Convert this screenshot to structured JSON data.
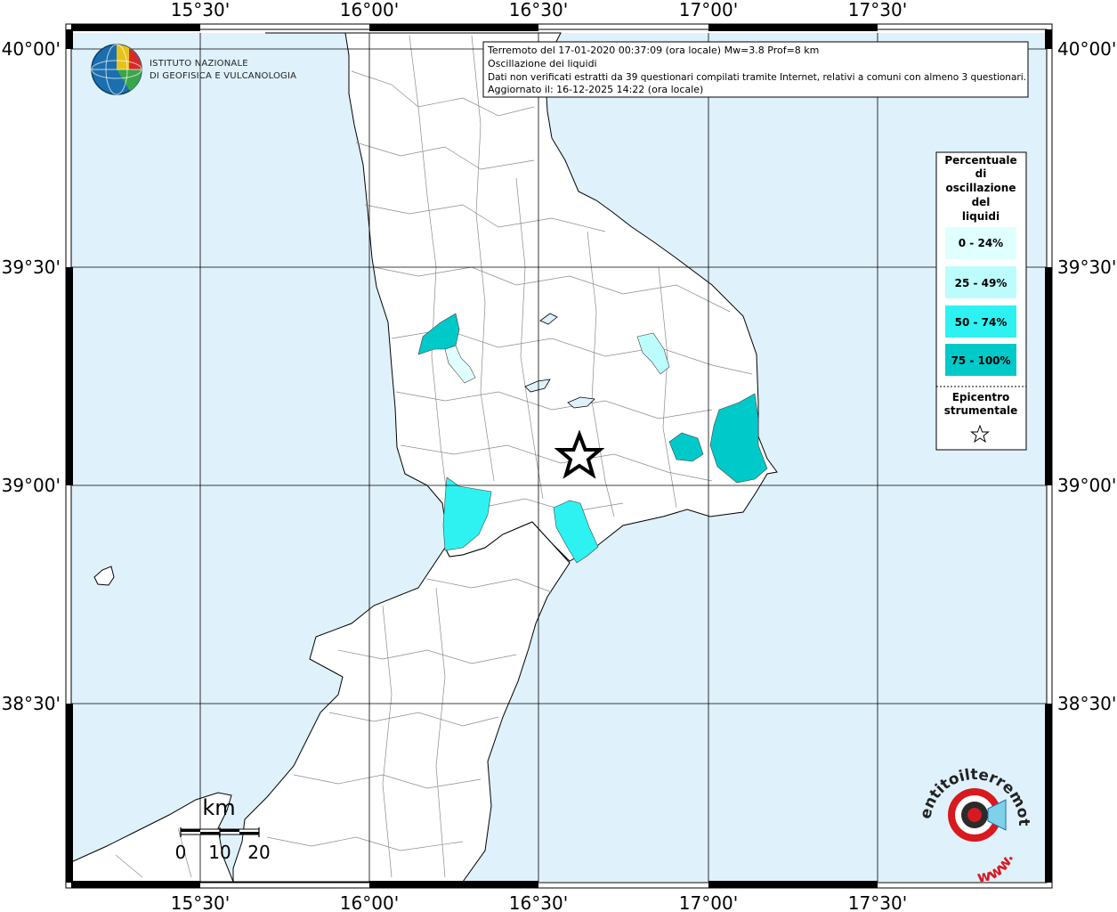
{
  "map": {
    "colors": {
      "sea": "#dff1fb",
      "land": "#ffffff",
      "coast": "#000000",
      "borders": "#8a8a8a",
      "grid": "#000000"
    },
    "longitude_labels": [
      "15°30'",
      "16°00'",
      "16°30'",
      "17°00'",
      "17°30'"
    ],
    "latitude_labels": [
      "40°00'",
      "39°30'",
      "39°00'",
      "38°30'"
    ]
  },
  "logo": {
    "line1": "ISTITUTO NAZIONALE",
    "line2": "DI GEOFISICA E VULCANOLOGIA"
  },
  "info": {
    "line1": "Terremoto del 17-01-2020 00:37:09 (ora locale) Mw=3.8 Prof=8 km",
    "line2": "Oscillazione dei liquidi",
    "line3": "Dati non verificati estratti da 39 questionari compilati tramite Internet, relativi a comuni con almeno 3 questionari.",
    "line4": "Aggiornato il: 16-12-2025 14:22 (ora locale)"
  },
  "legend": {
    "title_lines": [
      "Percentuale",
      "di",
      "oscillazione",
      "del",
      "liquidi"
    ],
    "classes": [
      {
        "label": "0 - 24%",
        "color": "#e0ffff"
      },
      {
        "label": "25 - 49%",
        "color": "#bdfcfc"
      },
      {
        "label": "50 - 74%",
        "color": "#2ef2f2"
      },
      {
        "label": "75 - 100%",
        "color": "#00c9c9"
      }
    ],
    "epicenter_lines": [
      "Epicentro",
      "strumentale"
    ],
    "star_icon": "star-outline-icon"
  },
  "scale_bar": {
    "unit": "km",
    "labels": [
      "0",
      "10",
      "20"
    ]
  },
  "watermark": {
    "text": "haisentitoilterremoto.it",
    "www": "www."
  }
}
